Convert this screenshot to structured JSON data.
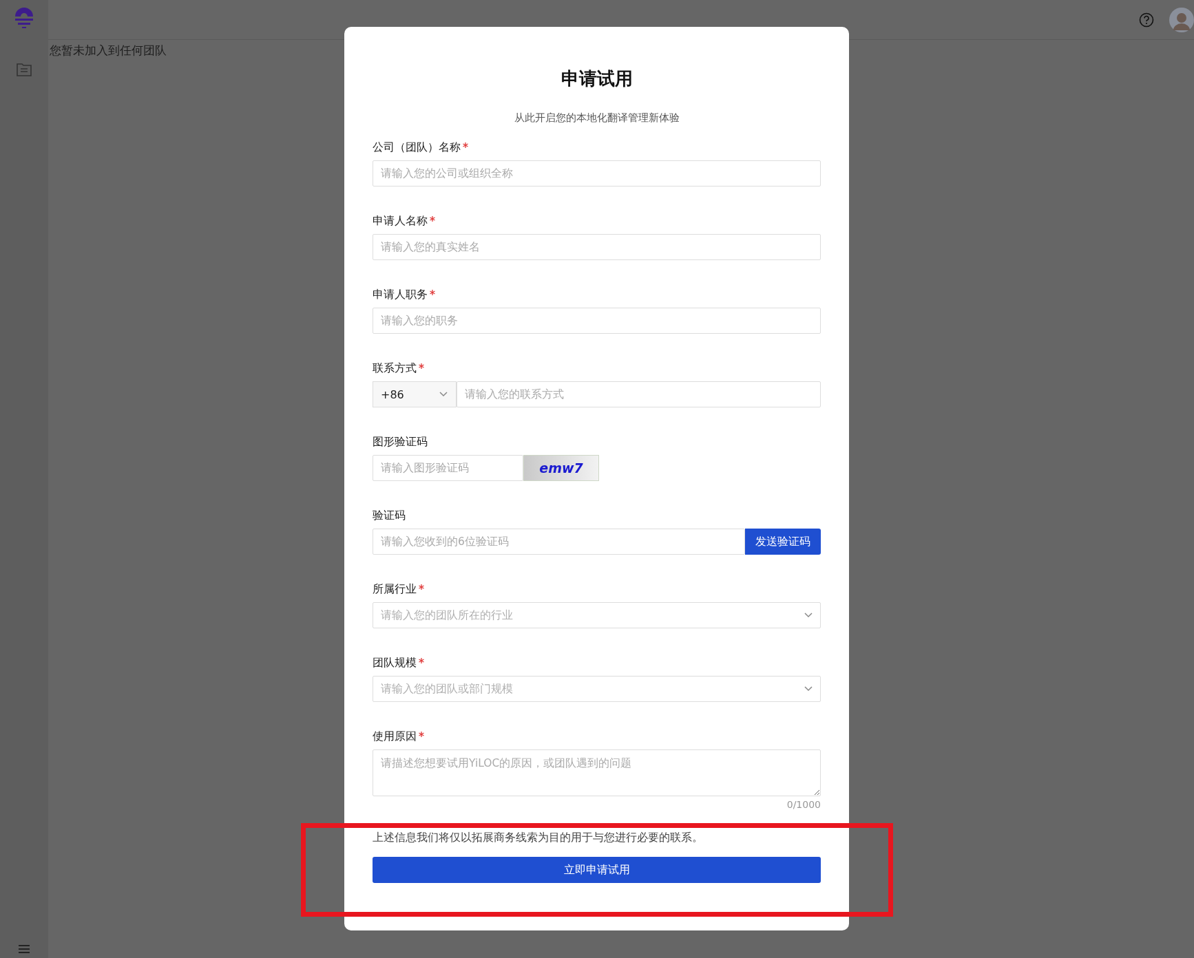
{
  "header": {
    "team_notice": "您暂未加入到任何团队"
  },
  "dialog": {
    "title": "申请试用",
    "subtitle": "从此开启您的本地化翻译管理新体验",
    "fields": [
      {
        "kind": "text",
        "label": "公司（团队）名称",
        "required": true,
        "placeholder": "请输入您的公司或组织全称"
      },
      {
        "kind": "text",
        "label": "申请人名称",
        "required": true,
        "placeholder": "请输入您的真实姓名"
      },
      {
        "kind": "text",
        "label": "申请人职务",
        "required": true,
        "placeholder": "请输入您的职务"
      },
      {
        "kind": "phone",
        "label": "联系方式",
        "required": true,
        "prefix": "+86",
        "placeholder": "请输入您的联系方式"
      },
      {
        "kind": "captcha",
        "label": "图形验证码",
        "required": false,
        "placeholder": "请输入图形验证码",
        "captcha_text": "emw7"
      },
      {
        "kind": "code",
        "label": "验证码",
        "required": false,
        "placeholder": "请输入您收到的6位验证码",
        "button": "发送验证码"
      },
      {
        "kind": "select",
        "label": "所属行业",
        "required": true,
        "placeholder": "请输入您的团队所在的行业"
      },
      {
        "kind": "select",
        "label": "团队规模",
        "required": true,
        "placeholder": "请输入您的团队或部门规模"
      },
      {
        "kind": "textarea",
        "label": "使用原因",
        "required": true,
        "placeholder": "请描述您想要试用YiLOC的原因，或团队遇到的问题",
        "counter": "0/1000"
      }
    ],
    "notice": "上述信息我们将仅以拓展商务线索为目的用于与您进行必要的联系。",
    "submit": "立即申请试用"
  }
}
